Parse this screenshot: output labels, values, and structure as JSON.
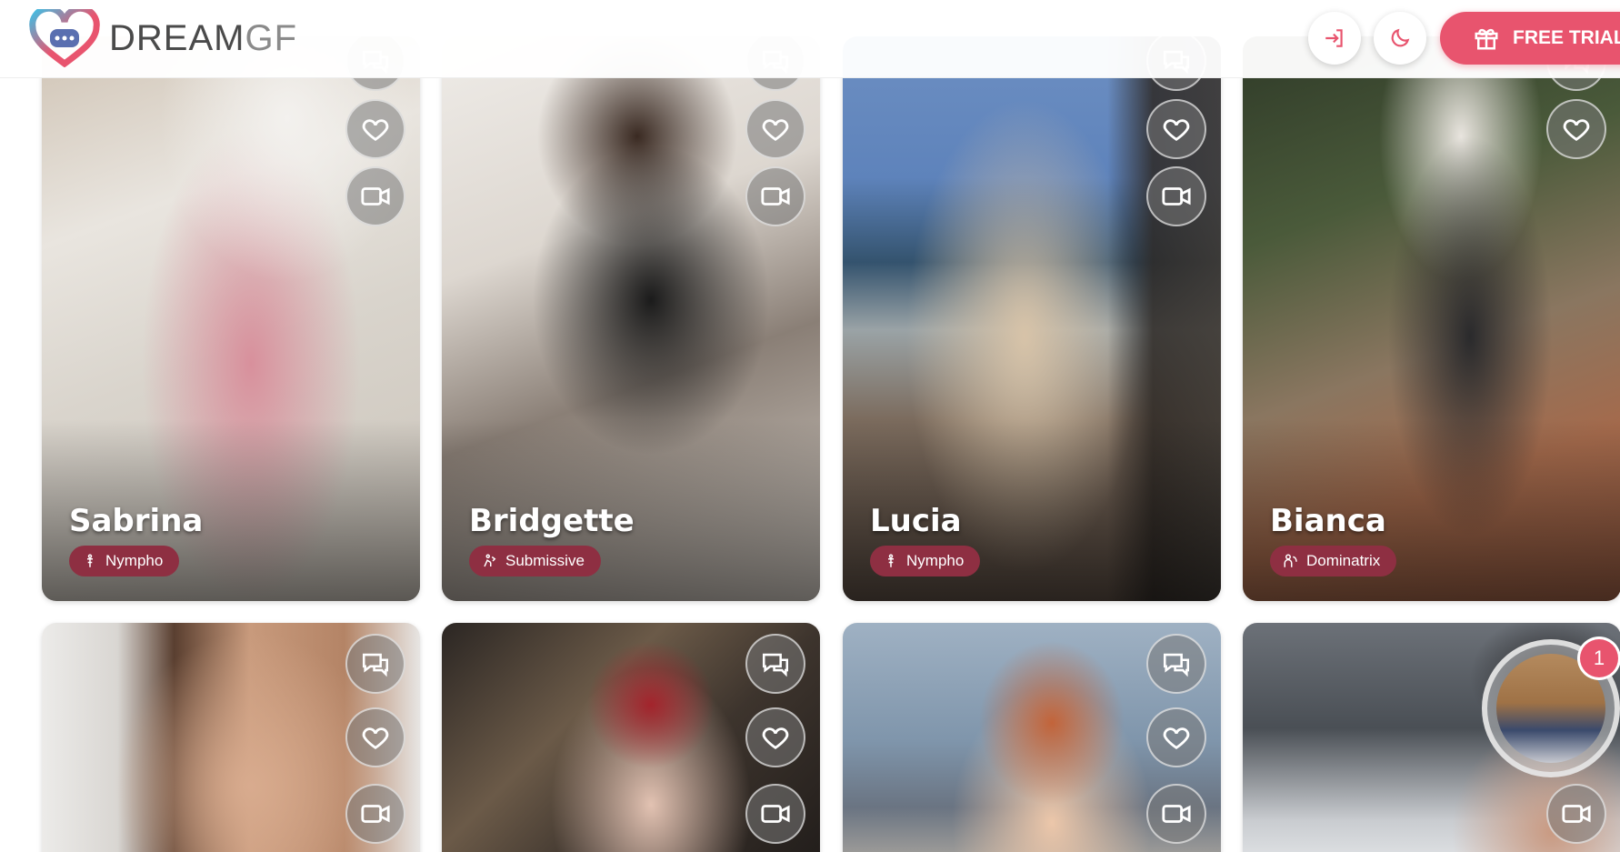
{
  "header": {
    "brand_main": "DREAM",
    "brand_accent": "GF",
    "login_icon": "login-arrow-icon",
    "theme_icon": "moon-icon",
    "trial_icon": "gift-icon",
    "trial_label": "FREE TRIAL"
  },
  "colors": {
    "accent": "#e8546e",
    "tag_bg": "#8e2f42"
  },
  "cards_row1": [
    {
      "name": "Sabrina",
      "tag": "Nympho",
      "tag_icon": "nympho-icon"
    },
    {
      "name": "Bridgette",
      "tag": "Submissive",
      "tag_icon": "submissive-icon"
    },
    {
      "name": "Lucia",
      "tag": "Nympho",
      "tag_icon": "nympho-icon"
    },
    {
      "name": "Bianca",
      "tag": "Dominatrix",
      "tag_icon": "dominatrix-icon"
    }
  ],
  "card_actions": [
    "chat-icon",
    "heart-icon",
    "video-icon"
  ],
  "story": {
    "badge_count": "1"
  }
}
